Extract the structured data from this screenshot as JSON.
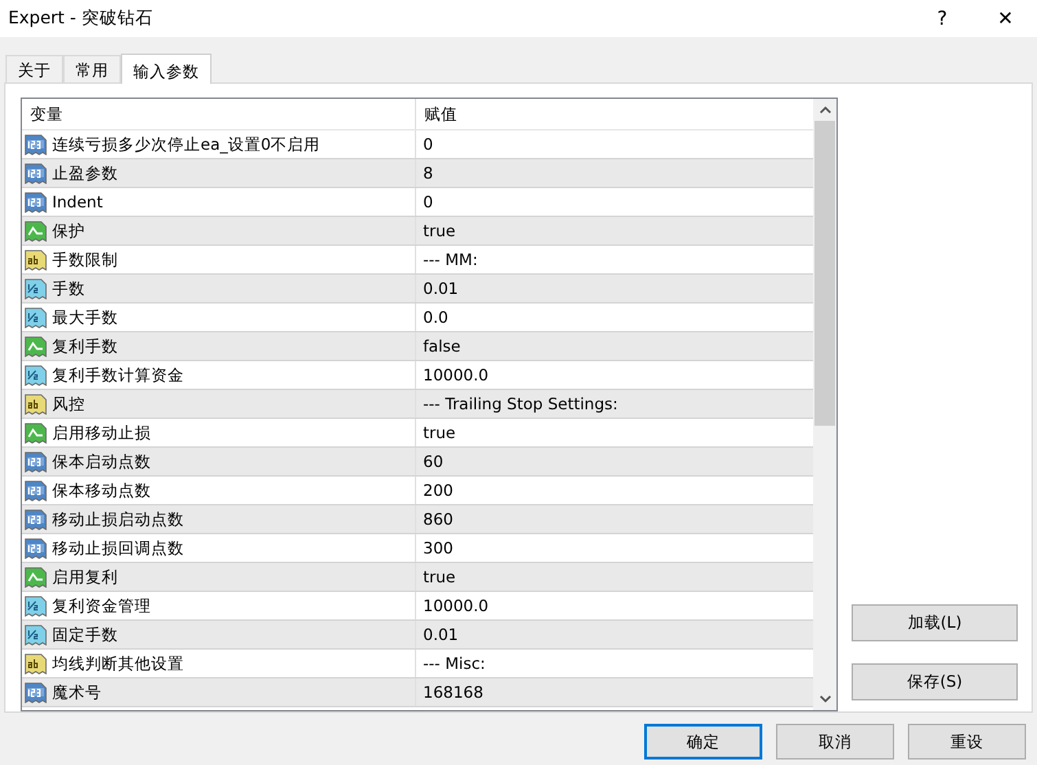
{
  "window": {
    "title": "Expert - 突破钻石",
    "help": "?",
    "close": "✕"
  },
  "tabs": [
    {
      "label": "关于",
      "selected": false
    },
    {
      "label": "常用",
      "selected": false
    },
    {
      "label": "输入参数",
      "selected": true
    }
  ],
  "table": {
    "columns": [
      "变量",
      "赋值"
    ],
    "rows": [
      {
        "kind": "int",
        "name": "连续亏损多少次停止ea_设置0不启用",
        "value": "0"
      },
      {
        "kind": "int",
        "name": "止盈参数",
        "value": "8"
      },
      {
        "kind": "int",
        "name": "Indent",
        "value": "0"
      },
      {
        "kind": "bool",
        "name": "保护",
        "value": "true"
      },
      {
        "kind": "string",
        "name": "手数限制",
        "value": "--- MM:"
      },
      {
        "kind": "double",
        "name": "手数",
        "value": "0.01"
      },
      {
        "kind": "double",
        "name": "最大手数",
        "value": "0.0"
      },
      {
        "kind": "bool",
        "name": "复利手数",
        "value": "false"
      },
      {
        "kind": "double",
        "name": "复利手数计算资金",
        "value": "10000.0"
      },
      {
        "kind": "string",
        "name": "风控",
        "value": "--- Trailing Stop Settings:"
      },
      {
        "kind": "bool",
        "name": "启用移动止损",
        "value": "true"
      },
      {
        "kind": "int",
        "name": "保本启动点数",
        "value": "60"
      },
      {
        "kind": "int",
        "name": "保本移动点数",
        "value": "200"
      },
      {
        "kind": "int",
        "name": "移动止损启动点数",
        "value": "860"
      },
      {
        "kind": "int",
        "name": "移动止损回调点数",
        "value": "300"
      },
      {
        "kind": "bool",
        "name": "启用复利",
        "value": "true"
      },
      {
        "kind": "double",
        "name": "复利资金管理",
        "value": "10000.0"
      },
      {
        "kind": "double",
        "name": "固定手数",
        "value": "0.01"
      },
      {
        "kind": "string",
        "name": "均线判断其他设置",
        "value": "--- Misc:"
      },
      {
        "kind": "int",
        "name": "魔术号",
        "value": "168168"
      }
    ]
  },
  "side_buttons": [
    "加载(L)",
    "保存(S)"
  ],
  "buttons": [
    {
      "label": "确定",
      "selected": true
    },
    {
      "label": "取消",
      "selected": false
    },
    {
      "label": "重设",
      "selected": false
    }
  ]
}
